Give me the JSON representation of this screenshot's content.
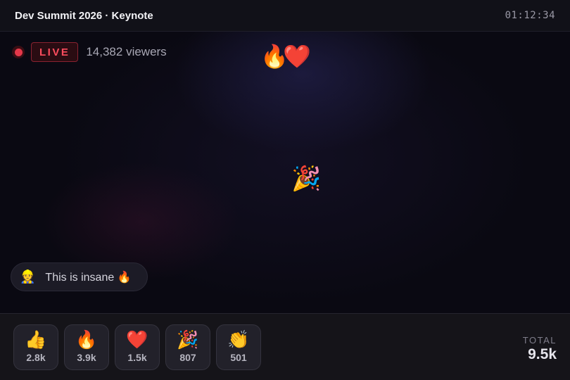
{
  "header": {
    "title": "Dev Summit 2026 · Keynote",
    "timer": "01:12:34"
  },
  "stream": {
    "live_label": "LIVE",
    "viewers": "14,382 viewers"
  },
  "floating_reactions": [
    "🔥",
    "❤️",
    "🎉"
  ],
  "chat": {
    "avatar": "👷",
    "message": "This is insane 🔥"
  },
  "reactions": [
    {
      "emoji": "👍",
      "count": "2.8k"
    },
    {
      "emoji": "🔥",
      "count": "3.9k"
    },
    {
      "emoji": "❤️",
      "count": "1.5k"
    },
    {
      "emoji": "🎉",
      "count": "807"
    },
    {
      "emoji": "👏",
      "count": "501"
    }
  ],
  "total": {
    "label": "TOTAL",
    "value": "9.5k"
  },
  "colors": {
    "live_accent": "#e5384a",
    "background": "#0b0a12"
  }
}
